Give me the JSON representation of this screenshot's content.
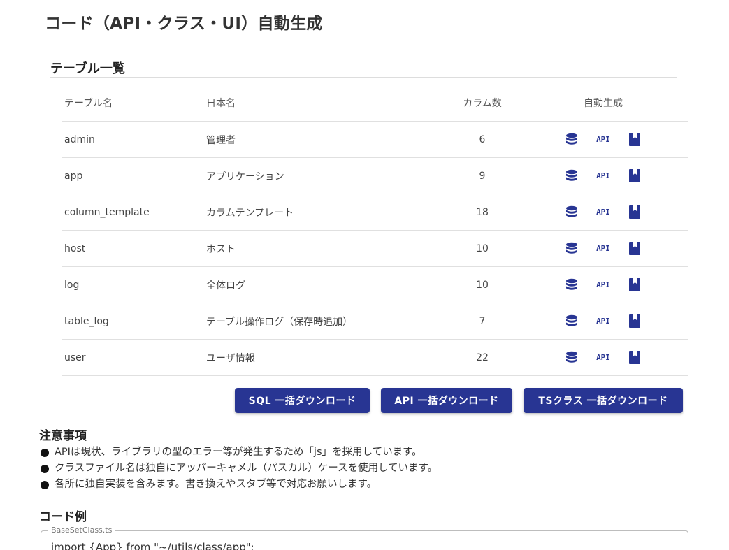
{
  "page": {
    "title": "コード（API・クラス・UI）自動生成"
  },
  "table_section": {
    "title": "テーブル一覧"
  },
  "table": {
    "headers": {
      "name": "テーブル名",
      "jp_name": "日本名",
      "columns": "カラム数",
      "generate": "自動生成"
    },
    "rows": [
      {
        "name": "admin",
        "jp_name": "管理者",
        "columns": "6"
      },
      {
        "name": "app",
        "jp_name": "アプリケーション",
        "columns": "9"
      },
      {
        "name": "column_template",
        "jp_name": "カラムテンプレート",
        "columns": "18"
      },
      {
        "name": "host",
        "jp_name": "ホスト",
        "columns": "10"
      },
      {
        "name": "log",
        "jp_name": "全体ログ",
        "columns": "10"
      },
      {
        "name": "table_log",
        "jp_name": "テーブル操作ログ（保存時追加）",
        "columns": "7"
      },
      {
        "name": "user",
        "jp_name": "ユーザ情報",
        "columns": "22"
      }
    ],
    "icons": {
      "sql": "database-icon",
      "api": "API",
      "class": "book-icon"
    }
  },
  "actions": {
    "sql_download": "SQL 一括ダウンロード",
    "api_download": "API 一括ダウンロード",
    "ts_download": "TSクラス 一括ダウンロード"
  },
  "notes": {
    "title": "注意事項",
    "items": [
      "APIは現状、ライブラリの型のエラー等が発生するため「js」を採用しています。",
      "クラスファイル名は独自にアッパーキャメル（パスカル）ケースを使用しています。",
      "各所に独自実装を含みます。書き換えやスタブ等で対応お願いします。"
    ]
  },
  "code_example": {
    "title": "コード例",
    "file_label": "BaseSetClass.ts",
    "first_line": "import {App} from \"~/utils/class/app\";"
  },
  "colors": {
    "primary": "#283593",
    "text": "#222222",
    "divider": "#e0e0e0"
  }
}
